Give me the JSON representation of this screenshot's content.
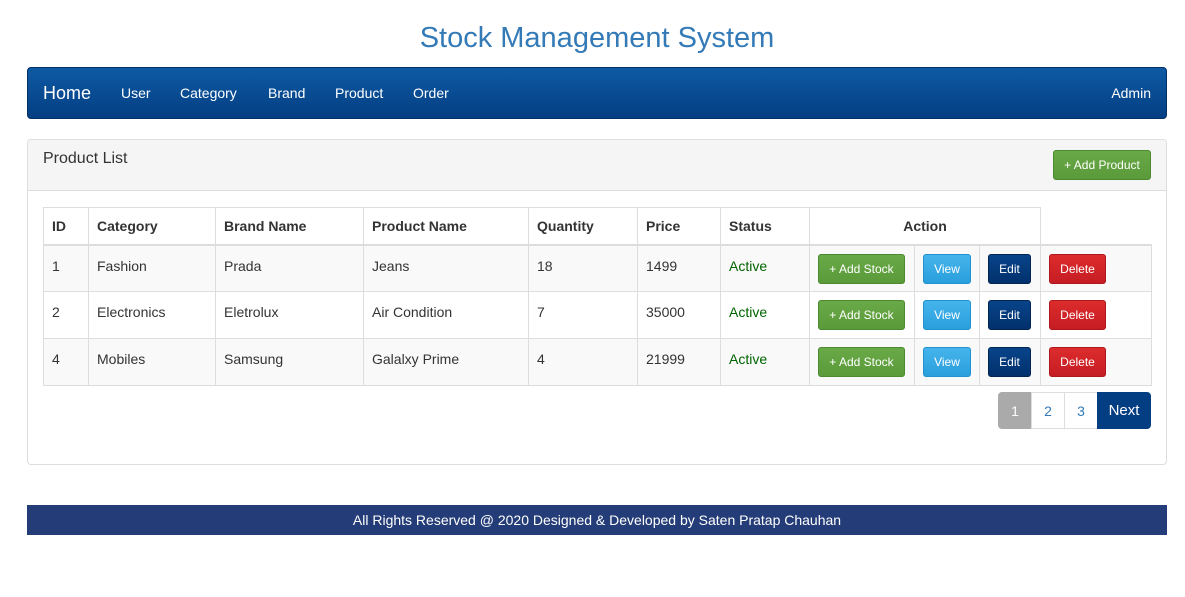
{
  "site": {
    "title": "Stock Management System"
  },
  "navbar": {
    "brand": "Home",
    "links": [
      "User",
      "Category",
      "Brand",
      "Product",
      "Order"
    ],
    "user": "Admin"
  },
  "panel": {
    "title": "Product List",
    "add_button": "+ Add Product"
  },
  "table": {
    "headers": [
      "ID",
      "Category",
      "Brand Name",
      "Product Name",
      "Quantity",
      "Price",
      "Status",
      "Action"
    ],
    "rows": [
      {
        "id": "1",
        "category": "Fashion",
        "brand": "Prada",
        "product": "Jeans",
        "quantity": "18",
        "price": "1499",
        "status": "Active"
      },
      {
        "id": "2",
        "category": "Electronics",
        "brand": "Eletrolux",
        "product": "Air Condition",
        "quantity": "7",
        "price": "35000",
        "status": "Active"
      },
      {
        "id": "4",
        "category": "Mobiles",
        "brand": "Samsung",
        "product": "Galalxy Prime",
        "quantity": "4",
        "price": "21999",
        "status": "Active"
      }
    ],
    "actions": {
      "add_stock": "+ Add Stock",
      "view": "View",
      "edit": "Edit",
      "delete": "Delete"
    }
  },
  "pagination": {
    "pages": [
      "1",
      "2",
      "3"
    ],
    "current": "1",
    "next": "Next"
  },
  "footer": {
    "text": "All Rights Reserved @ 2020 Designed & Developed by Saten Pratap Chauhan"
  },
  "colors": {
    "navbar": "#043e82",
    "title": "#337ab7",
    "footer": "#243c77",
    "success": "#5b9a3a",
    "info": "#2a9fdc",
    "danger": "#c51d24"
  }
}
